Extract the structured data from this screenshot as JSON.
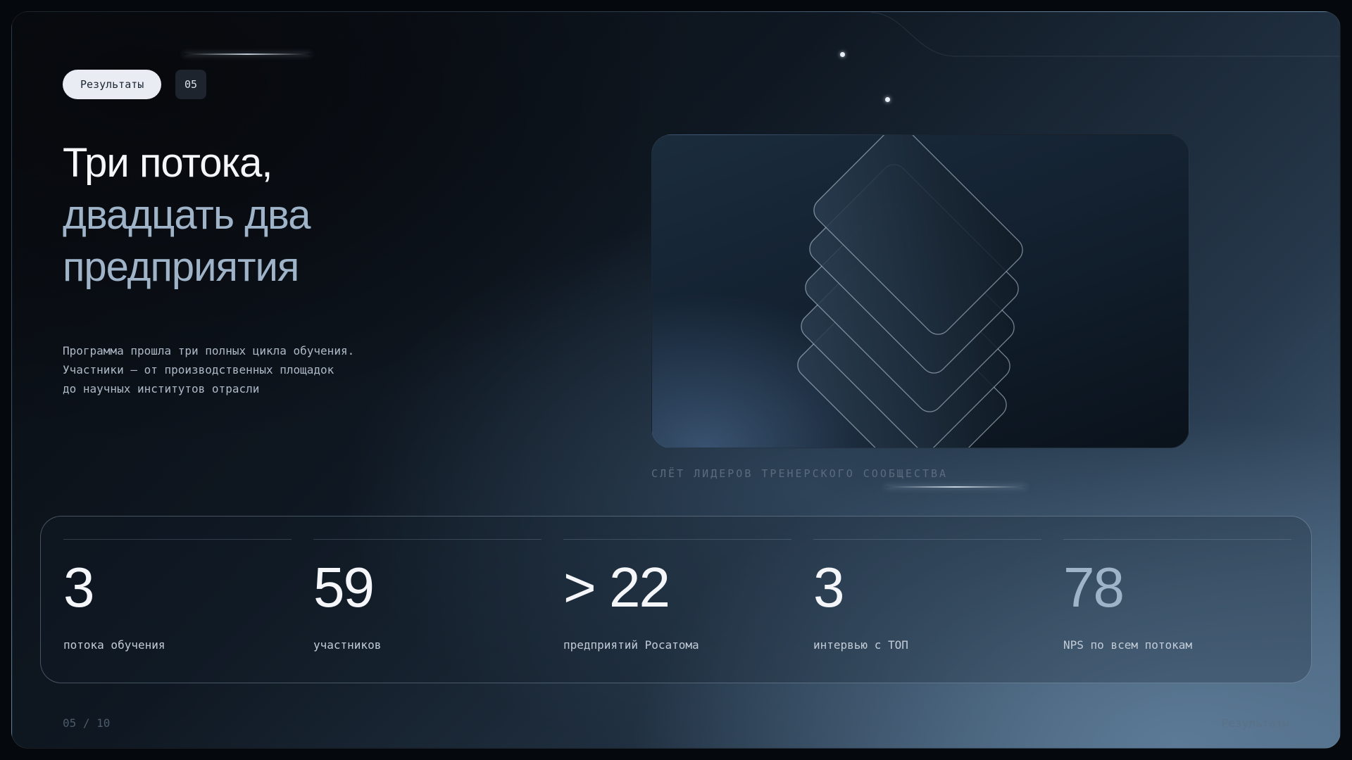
{
  "slide": {
    "section_tag": "Результаты",
    "section_number": "05",
    "title_line1": "Три потока,",
    "title_line2": "двадцать два",
    "title_line3": "предприятия",
    "description": [
      "Программа прошла три полных цикла обучения.",
      "Участники — от производственных площадок",
      "до научных институтов отрасли"
    ],
    "image_caption": "СЛЁТ ЛИДЕРОВ ТРЕНЕРСКОГО СООБЩЕСТВА",
    "image_icon": "stacked-cards-icon"
  },
  "stats": [
    {
      "value": "3",
      "label": "потока обучения",
      "accent": false
    },
    {
      "value": "59",
      "label": "участников",
      "accent": false
    },
    {
      "value": "> 22",
      "label": "предприятий Росатома",
      "accent": false
    },
    {
      "value": "3",
      "label": "интервью с ТОП",
      "accent": false
    },
    {
      "value": "78",
      "label": "NPS по всем потокам",
      "accent": true
    }
  ],
  "footer": {
    "page_indicator": "05 / 10",
    "section_name": "Результаты"
  },
  "colors": {
    "text_primary": "#f4f6f9",
    "text_accent": "#9fb4c8",
    "pill_background": "#e9edf3",
    "background_dark": "#080b10",
    "background_light": "#4a6580"
  }
}
